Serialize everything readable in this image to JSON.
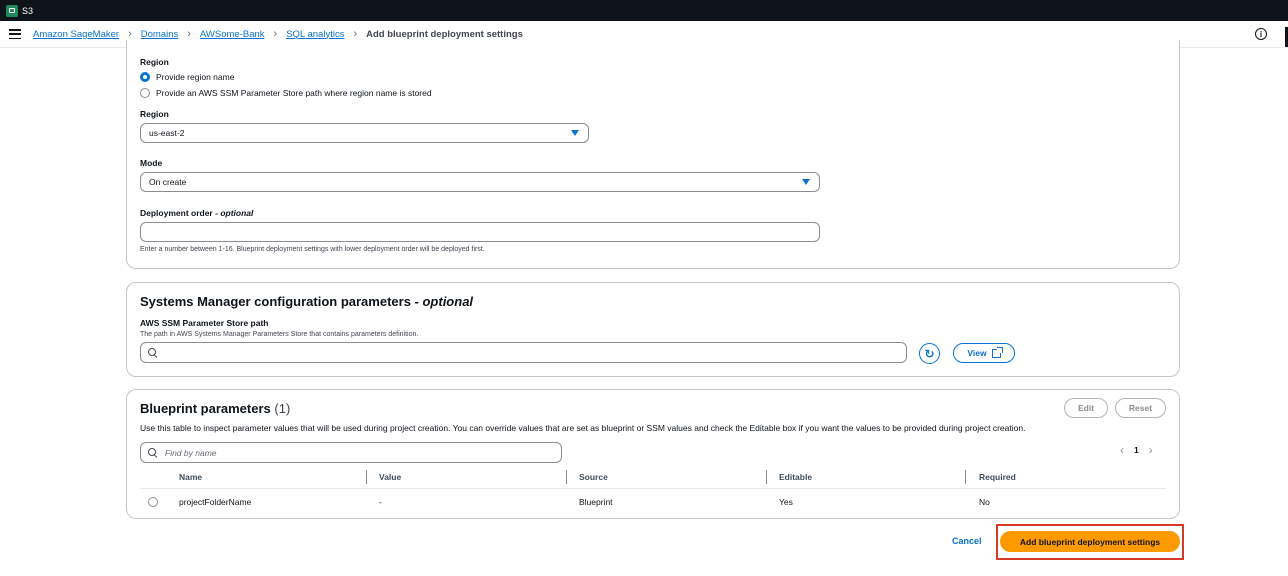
{
  "topbar": {
    "service_name": "S3",
    "icon": "s3-service-icon"
  },
  "breadcrumb": {
    "items": [
      "Amazon SageMaker",
      "Domains",
      "AWSome-Bank",
      "SQL analytics"
    ],
    "current": "Add blueprint deployment settings"
  },
  "region_section": {
    "label": "Region",
    "options": [
      "Provide region name",
      "Provide an AWS SSM Parameter Store path where region name is stored"
    ],
    "selected_option": "Provide region name",
    "region_label": "Region",
    "region_value": "us-east-2",
    "mode_label": "Mode",
    "mode_value": "On create",
    "deploy_order_label": "Deployment order -",
    "deploy_order_optional": "optional",
    "deploy_order_value": "",
    "deploy_order_hint": "Enter a number between 1-16. Blueprint deployment settings with lower deployment order will be deployed first."
  },
  "ssm_section": {
    "title": "Systems Manager configuration parameters -",
    "title_optional": "optional",
    "path_label": "AWS SSM Parameter Store path",
    "path_hint": "The path in AWS Systems Manager Parameters Store that contains parameters definition.",
    "path_value": "",
    "view_label": "View"
  },
  "blueprint_params": {
    "title": "Blueprint parameters",
    "count": "(1)",
    "edit_label": "Edit",
    "reset_label": "Reset",
    "description": "Use this table to inspect parameter values that will be used during project creation. You can override values that are set as blueprint or SSM values and check the Editable box if you want the values to be provided during project creation.",
    "search_placeholder": "Find by name",
    "page": "1",
    "columns": [
      "Name",
      "Value",
      "Source",
      "Editable",
      "Required"
    ],
    "rows": [
      {
        "name": "projectFolderName",
        "value": "-",
        "source": "Blueprint",
        "editable": "Yes",
        "required": "No"
      }
    ]
  },
  "footer": {
    "cancel_label": "Cancel",
    "primary_label": "Add blueprint deployment settings"
  },
  "colors": {
    "accent": "#0972d3",
    "primary_button": "#ff9900",
    "highlight_border": "#d63b2a",
    "topbar": "#0f141a"
  }
}
